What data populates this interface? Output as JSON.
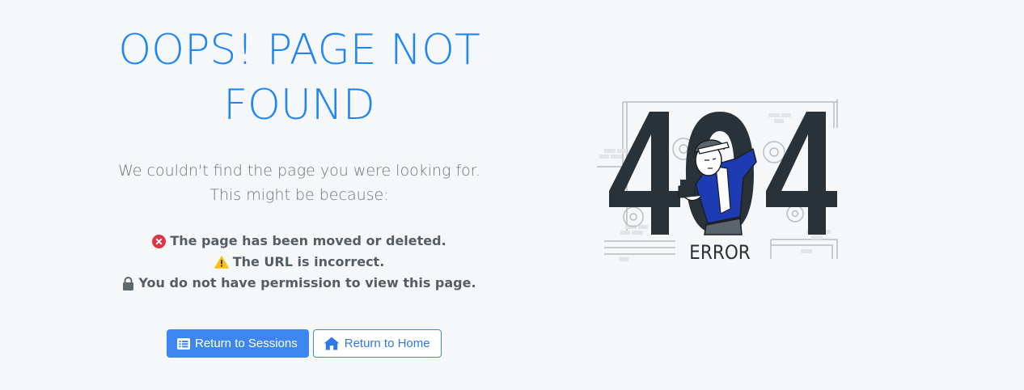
{
  "title": "OOPS! PAGE NOT FOUND",
  "subtitle": "We couldn't find the page you were looking for. This might be because:",
  "reasons": [
    {
      "text": "The page has been moved or deleted.",
      "icon": "error-circle-icon"
    },
    {
      "text": "The URL is incorrect.",
      "icon": "warning-icon"
    },
    {
      "text": "You do not have permission to view this page.",
      "icon": "lock-icon"
    }
  ],
  "buttons": {
    "sessions": "Return to Sessions",
    "home": "Return to Home"
  },
  "illustration": {
    "digits": "404",
    "label": "ERROR"
  },
  "colors": {
    "accent": "#1f86f2",
    "primary_button": "#3d86f0",
    "error": "#dc3545",
    "warning": "#ffc107",
    "text_muted": "#6c757d"
  }
}
